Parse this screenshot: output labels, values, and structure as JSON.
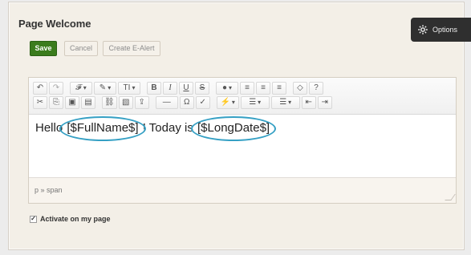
{
  "panel": {
    "title": "Page Welcome"
  },
  "actions": {
    "save_label": "Save",
    "cancel_label": "Cancel",
    "create_alert_label": "Create E-Alert",
    "options_label": "Options"
  },
  "toolbar": {
    "row1": [
      {
        "kind": "undo-icon",
        "label": "↶"
      },
      {
        "kind": "redo-icon",
        "label": "↷",
        "disabled": true
      },
      {
        "kind": "font-family-icon",
        "label": "𝓕",
        "caret": true
      },
      {
        "kind": "pen-icon",
        "label": "✎",
        "caret": true
      },
      {
        "kind": "text-height-icon",
        "label": "TI",
        "caret": true
      },
      {
        "kind": "bold-button",
        "label": "B"
      },
      {
        "kind": "italic-button",
        "label": "I"
      },
      {
        "kind": "underline-button",
        "label": "U"
      },
      {
        "kind": "strikethrough-button",
        "label": "S"
      },
      {
        "kind": "color-icon",
        "label": "●",
        "caret": true
      },
      {
        "kind": "align-left-icon",
        "label": "≡"
      },
      {
        "kind": "align-center-icon",
        "label": "≡"
      },
      {
        "kind": "align-right-icon",
        "label": "≡"
      },
      {
        "kind": "code-view-icon",
        "label": "◇"
      },
      {
        "kind": "help-icon",
        "label": "?"
      }
    ],
    "row2": [
      {
        "kind": "cut-icon",
        "label": "✂"
      },
      {
        "kind": "copy-icon",
        "label": "⎘"
      },
      {
        "kind": "paste-icon",
        "label": "▣"
      },
      {
        "kind": "paste-text-icon",
        "label": "▤"
      },
      {
        "kind": "link-icon",
        "label": "⛓"
      },
      {
        "kind": "image-icon",
        "label": "▧"
      },
      {
        "kind": "upload-icon",
        "label": "⇪"
      },
      {
        "kind": "horizontal-rule-icon",
        "label": "—"
      },
      {
        "kind": "special-character-icon",
        "label": "Ω"
      },
      {
        "kind": "spellcheck-icon",
        "label": "✓"
      },
      {
        "kind": "flash-icon",
        "label": "⚡",
        "caret": true
      },
      {
        "kind": "bulleted-list-icon",
        "label": "☰",
        "caret": true
      },
      {
        "kind": "numbered-list-icon",
        "label": "☰",
        "caret": true
      },
      {
        "kind": "outdent-icon",
        "label": "⇤"
      },
      {
        "kind": "indent-icon",
        "label": "⇥"
      }
    ]
  },
  "editor": {
    "prefix": "Hello ",
    "token1": "[$FullName$]",
    "middle": "! Today is ",
    "token2": "[$LongDate$]",
    "path": "p » span"
  },
  "activation": {
    "label": "Activate on my page",
    "checked": true
  },
  "colors": {
    "accent_green": "#3b7c1d",
    "highlight_blue": "#35a0c4",
    "dark_options": "#2f2f2f"
  }
}
